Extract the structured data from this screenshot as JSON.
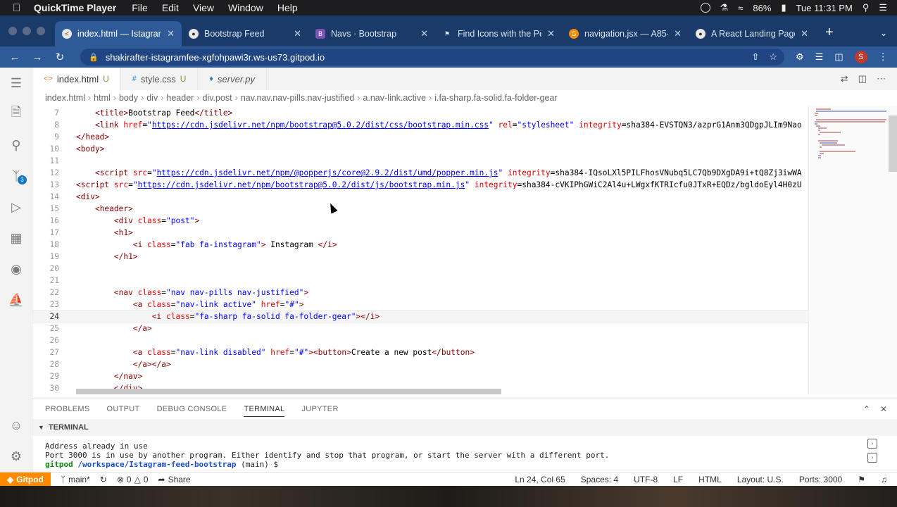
{
  "menubar": {
    "app": "QuickTime Player",
    "items": [
      "File",
      "Edit",
      "View",
      "Window",
      "Help"
    ],
    "battery": "86%",
    "clock": "Tue 11:31 PM"
  },
  "browser": {
    "tabs": [
      {
        "title": "index.html — Istagram",
        "icon": "vscode-icon",
        "active": true
      },
      {
        "title": "Bootstrap Feed",
        "icon": "globe-icon",
        "active": false
      },
      {
        "title": "Navs · Bootstrap",
        "icon": "bootstrap-icon",
        "active": false
      },
      {
        "title": "Find Icons with the Pe",
        "icon": "flag-icon",
        "active": false
      },
      {
        "title": "navigation.jsx — A85-",
        "icon": "gitpod-icon",
        "active": false
      },
      {
        "title": "A React Landing Page",
        "icon": "globe-icon",
        "active": false
      }
    ],
    "url": "shakirafter-istagramfee-xgfohpawi3r.ws-us73.gitpod.io",
    "profile_initial": "S"
  },
  "editor": {
    "tabs": [
      {
        "label": "index.html",
        "mark": "U",
        "kind": "html",
        "active": true
      },
      {
        "label": "style.css",
        "mark": "U",
        "kind": "css",
        "active": false
      },
      {
        "label": "server.py",
        "mark": "",
        "kind": "py",
        "active": false
      }
    ],
    "breadcrumbs": [
      "index.html",
      "html",
      "body",
      "div",
      "header",
      "div.post",
      "nav.nav.nav-pills.nav-justified",
      "a.nav-link.active",
      "i.fa-sharp.fa-solid.fa-folder-gear"
    ],
    "lines": [
      {
        "n": "7",
        "text": "    <title>Bootstrap Feed</title>"
      },
      {
        "n": "8",
        "text": "    <link href=\"https://cdn.jsdelivr.net/npm/bootstrap@5.0.2/dist/css/bootstrap.min.css\" rel=\"stylesheet\" integrity=\"sha384-EVSTQN3/azprG1Anm3QDgpJLIm9Nao"
      },
      {
        "n": "9",
        "text": "</head>"
      },
      {
        "n": "10",
        "text": "<body>"
      },
      {
        "n": "11",
        "text": ""
      },
      {
        "n": "12",
        "text": "    <script src=\"https://cdn.jsdelivr.net/npm/@popperjs/core@2.9.2/dist/umd/popper.min.js\" integrity=\"sha384-IQsoLXl5PILFhosVNubq5LC7Qb9DXgDA9i+tQ8Zj3iwWA"
      },
      {
        "n": "13",
        "text": "<script src=\"https://cdn.jsdelivr.net/npm/bootstrap@5.0.2/dist/js/bootstrap.min.js\" integrity=\"sha384-cVKIPhGWiC2Al4u+LWgxfKTRIcfu0JTxR+EQDz/bgldoEyl4H0zU"
      },
      {
        "n": "14",
        "text": "<div>"
      },
      {
        "n": "15",
        "text": "    <header>"
      },
      {
        "n": "16",
        "text": "        <div class=\"post\">"
      },
      {
        "n": "17",
        "text": "        <h1>"
      },
      {
        "n": "18",
        "text": "            <i class=\"fab fa-instagram\"> Instagram </i>"
      },
      {
        "n": "19",
        "text": "        </h1>"
      },
      {
        "n": "20",
        "text": ""
      },
      {
        "n": "21",
        "text": ""
      },
      {
        "n": "22",
        "text": "        <nav class=\"nav nav-pills nav-justified\">"
      },
      {
        "n": "23",
        "text": "            <a class=\"nav-link active\" href=\"#\">"
      },
      {
        "n": "24",
        "text": "                <i class=\"fa-sharp fa-solid fa-folder-gear\"></i>"
      },
      {
        "n": "25",
        "text": "            </a>"
      },
      {
        "n": "26",
        "text": ""
      },
      {
        "n": "27",
        "text": "            <a class=\"nav-link disabled\" href=\"#\"><button>Create a new post</button>"
      },
      {
        "n": "28",
        "text": "            </a></a>"
      },
      {
        "n": "29",
        "text": "        </nav>"
      },
      {
        "n": "30",
        "text": "        </div>"
      }
    ],
    "current_line": "24"
  },
  "panel": {
    "tabs": [
      "PROBLEMS",
      "OUTPUT",
      "DEBUG CONSOLE",
      "TERMINAL",
      "JUPYTER"
    ],
    "active_tab": "TERMINAL",
    "terminal_title": "TERMINAL",
    "output": [
      "Address already in use",
      "Port 3000 is in use by another program. Either identify and stop that program, or start the server with a different port."
    ],
    "prompt_user": "gitpod",
    "prompt_path": "/workspace/Istagram-feed-bootstrap",
    "prompt_branch": "(main) $"
  },
  "statusbar": {
    "gitpod": "Gitpod",
    "branch": "main*",
    "errors": "0",
    "warnings": "0",
    "share": "Share",
    "position": "Ln 24, Col 65",
    "spaces": "Spaces: 4",
    "encoding": "UTF-8",
    "eol": "LF",
    "language": "HTML",
    "layout": "Layout: U.S.",
    "ports": "Ports: 3000"
  }
}
